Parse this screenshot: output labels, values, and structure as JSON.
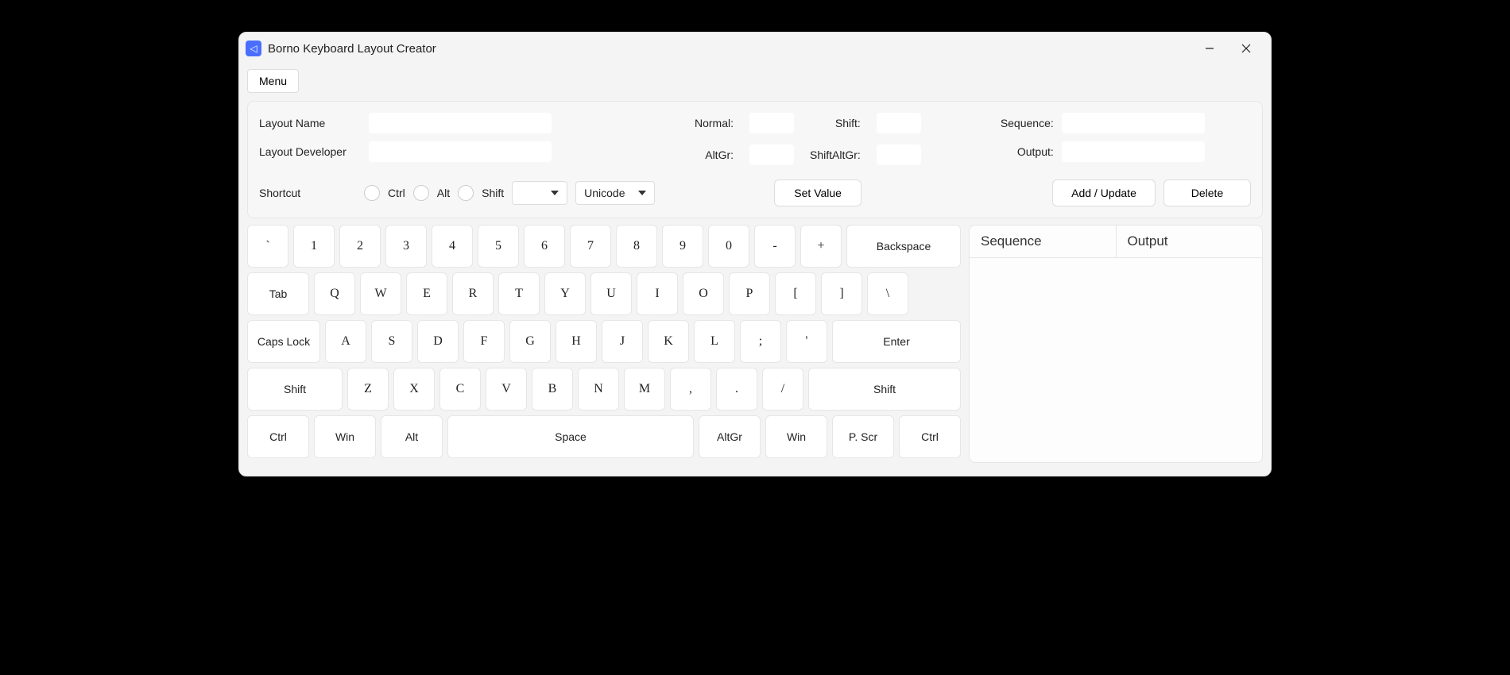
{
  "window": {
    "title": "Borno Keyboard Layout Creator"
  },
  "menu": {
    "label": "Menu"
  },
  "form": {
    "layoutNameLabel": "Layout Name",
    "layoutDevLabel": "Layout Developer",
    "normalLabel": "Normal:",
    "shiftLabel": "Shift:",
    "altgrLabel": "AltGr:",
    "shiftAltgrLabel": "ShiftAltGr:",
    "sequenceLabel": "Sequence:",
    "outputLabel": "Output:",
    "shortcutLabel": "Shortcut",
    "ctrlLabel": "Ctrl",
    "altLabel": "Alt",
    "shiftModLabel": "Shift",
    "encodingSelected": "Unicode",
    "setValueBtn": "Set Value",
    "addUpdateBtn": "Add / Update",
    "deleteBtn": "Delete",
    "layoutNameValue": "",
    "layoutDevValue": "",
    "normalValue": "",
    "shiftValue": "",
    "altgrValue": "",
    "shiftAltgrValue": "",
    "sequenceValue": "",
    "outputValue": "",
    "shortcutKeySelected": ""
  },
  "keyboard": {
    "row1": [
      "`",
      "1",
      "2",
      "3",
      "4",
      "5",
      "6",
      "7",
      "8",
      "9",
      "0",
      "-",
      "+"
    ],
    "backspace": "Backspace",
    "tab": "Tab",
    "row2": [
      "Q",
      "W",
      "E",
      "R",
      "T",
      "Y",
      "U",
      "I",
      "O",
      "P",
      "[",
      "]",
      "\\"
    ],
    "caps": "Caps Lock",
    "row3": [
      "A",
      "S",
      "D",
      "F",
      "G",
      "H",
      "J",
      "K",
      "L",
      ";",
      "'"
    ],
    "enter": "Enter",
    "lshift": "Shift",
    "row4": [
      "Z",
      "X",
      "C",
      "V",
      "B",
      "N",
      "M",
      ",",
      ".",
      "/"
    ],
    "rshift": "Shift",
    "row5": {
      "ctrl": "Ctrl",
      "win": "Win",
      "alt": "Alt",
      "space": "Space",
      "altgr": "AltGr",
      "win2": "Win",
      "pscr": "P. Scr",
      "ctrl2": "Ctrl"
    }
  },
  "table": {
    "seqHeader": "Sequence",
    "outHeader": "Output"
  }
}
